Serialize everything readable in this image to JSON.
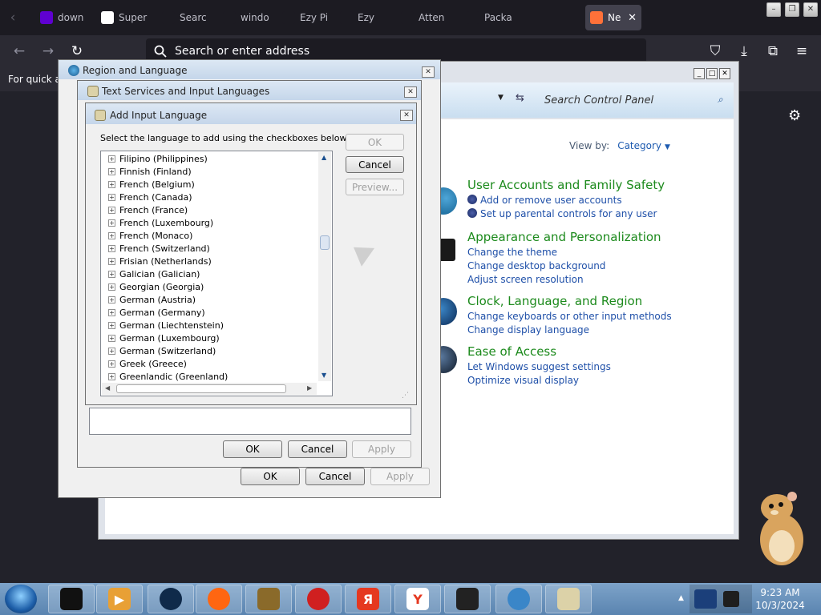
{
  "browser": {
    "tabs": [
      {
        "label": "down",
        "icon": "yahoo-icon",
        "color": "#5f01d1"
      },
      {
        "label": "Super",
        "icon": "s-icon",
        "color": "#ffffff"
      },
      {
        "label": "Searc",
        "icon": "search-tab-icon",
        "color": "#1c1b22"
      },
      {
        "label": "windo",
        "icon": "wind-icon",
        "color": "#1c1b22"
      },
      {
        "label": "Ezy Pi",
        "icon": "ezy-icon",
        "color": "#1c1b22"
      },
      {
        "label": "Ezy",
        "icon": "ezy-icon",
        "color": "#1c1b22"
      },
      {
        "label": "Atten",
        "icon": "atten-icon",
        "color": "#1c1b22"
      },
      {
        "label": "Packa",
        "icon": "package-icon",
        "color": "#1c1b22"
      },
      {
        "label": "Ne",
        "icon": "firefox-icon",
        "color": "#ff7139",
        "active": true
      }
    ],
    "close_tab_label": "✕",
    "address_placeholder": "Search or enter address",
    "bookmarks_text": "For quick ac"
  },
  "control_panel": {
    "search_placeholder": "Search Control Panel",
    "view_by_label": "View by:",
    "view_by_value": "Category",
    "categories": [
      {
        "title": "User Accounts and Family Safety",
        "links": [
          "Add or remove user accounts",
          "Set up parental controls for any user"
        ]
      },
      {
        "title": "Appearance and Personalization",
        "links": [
          "Change the theme",
          "Change desktop background",
          "Adjust screen resolution"
        ]
      },
      {
        "title": "Clock, Language, and Region",
        "links": [
          "Change keyboards or other input methods",
          "Change display language"
        ]
      },
      {
        "title": "Ease of Access",
        "links": [
          "Let Windows suggest settings",
          "Optimize visual display"
        ]
      }
    ]
  },
  "region_dialog": {
    "title": "Region and Language",
    "ok": "OK",
    "cancel": "Cancel",
    "apply": "Apply"
  },
  "text_services_dialog": {
    "title": "Text Services and Input Languages",
    "ok": "OK",
    "cancel": "Cancel",
    "apply": "Apply"
  },
  "add_language_dialog": {
    "title": "Add Input Language",
    "instruction": "Select the language to add using the checkboxes below.",
    "ok": "OK",
    "cancel": "Cancel",
    "preview": "Preview...",
    "expander": "+",
    "languages": [
      "Filipino (Philippines)",
      "Finnish (Finland)",
      "French (Belgium)",
      "French (Canada)",
      "French (France)",
      "French (Luxembourg)",
      "French (Monaco)",
      "French (Switzerland)",
      "Frisian (Netherlands)",
      "Galician (Galician)",
      "Georgian (Georgia)",
      "German (Austria)",
      "German (Germany)",
      "German (Liechtenstein)",
      "German (Luxembourg)",
      "German (Switzerland)",
      "Greek (Greece)",
      "Greenlandic (Greenland)"
    ]
  },
  "taskbar": {
    "items": [
      {
        "name": "taskbar-item-terminal",
        "icon": "terminal-icon",
        "color": "#111111",
        "glyph": ""
      },
      {
        "name": "taskbar-item-media-player",
        "icon": "media-player-icon",
        "color": "#e8a035",
        "glyph": "▶"
      },
      {
        "name": "taskbar-item-globe",
        "icon": "globe-icon",
        "color": "#0f2a4a",
        "glyph": ""
      },
      {
        "name": "taskbar-item-firefox",
        "icon": "firefox-icon",
        "color": "#ff6611",
        "glyph": ""
      },
      {
        "name": "taskbar-item-box",
        "icon": "box-game-icon",
        "color": "#8a6a2a",
        "glyph": ""
      },
      {
        "name": "taskbar-item-color-wheel",
        "icon": "color-wheel-icon",
        "color": "#d02020",
        "glyph": ""
      },
      {
        "name": "taskbar-item-yandex-browser",
        "icon": "yandex-icon",
        "color": "#e53820",
        "glyph": "Я"
      },
      {
        "name": "taskbar-item-yandex",
        "icon": "yandex-y-icon",
        "color": "#ffffff",
        "glyph": "Y"
      },
      {
        "name": "taskbar-item-monitor",
        "icon": "monitor-icon",
        "color": "#222222",
        "glyph": ""
      },
      {
        "name": "taskbar-item-network",
        "icon": "network-globe-icon",
        "color": "#3a86c8",
        "glyph": ""
      },
      {
        "name": "taskbar-item-keyboard",
        "icon": "keyboard-icon",
        "color": "#dcd2a8",
        "glyph": ""
      }
    ],
    "time": "9:23 AM",
    "date": "10/3/2024"
  }
}
